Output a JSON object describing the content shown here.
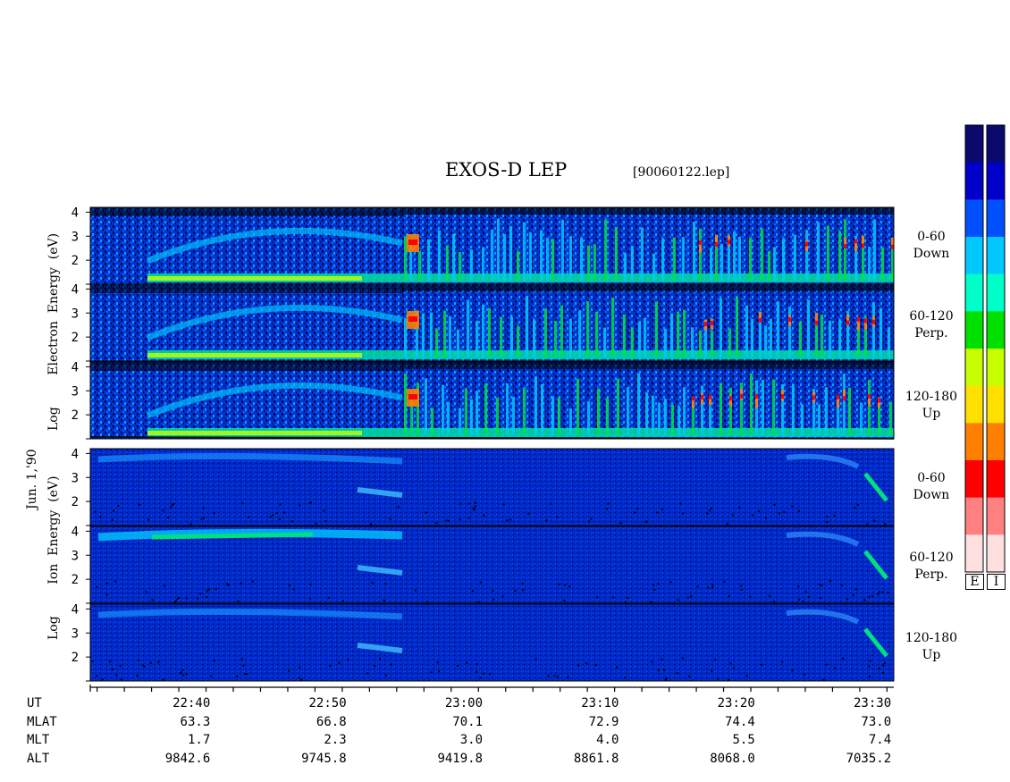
{
  "chart_data": {
    "type": "heatmap",
    "title": "EXOS-D LEP",
    "file_label": "[90060122.lep]",
    "date_label": "Jun. 1,'90",
    "groups": [
      {
        "species": "Electron",
        "ylabel_parts": [
          "Log",
          "Electron",
          "Energy",
          "(eV)"
        ],
        "panels": [
          {
            "pitch": "0-60",
            "direction": "Down"
          },
          {
            "pitch": "60-120",
            "direction": "Perp."
          },
          {
            "pitch": "120-180",
            "direction": "Up"
          }
        ]
      },
      {
        "species": "Ion",
        "ylabel_parts": [
          "Log",
          "Ion",
          "Energy",
          "(eV)"
        ],
        "panels": [
          {
            "pitch": "0-60",
            "direction": "Down"
          },
          {
            "pitch": "60-120",
            "direction": "Perp."
          },
          {
            "pitch": "120-180",
            "direction": "Up"
          }
        ]
      }
    ],
    "y_ticks": [
      "2",
      "3",
      "4"
    ],
    "ylim": [
      1,
      4.2
    ],
    "x_ticks": [
      "22:40",
      "22:50",
      "23:00",
      "23:10",
      "23:20",
      "23:30"
    ],
    "orbit_rows": [
      {
        "name": "UT",
        "values": [
          "22:40",
          "22:50",
          "23:00",
          "23:10",
          "23:20",
          "23:30"
        ]
      },
      {
        "name": "MLAT",
        "values": [
          "63.3",
          "66.8",
          "70.1",
          "72.9",
          "74.4",
          "73.0"
        ]
      },
      {
        "name": "MLT",
        "values": [
          "1.7",
          "2.3",
          "3.0",
          "4.0",
          "5.5",
          "7.4"
        ]
      },
      {
        "name": "ALT",
        "values": [
          "9842.6",
          "9745.8",
          "9419.8",
          "8861.8",
          "8068.0",
          "7035.2"
        ]
      }
    ],
    "colorbars": [
      {
        "label": "E"
      },
      {
        "label": "I"
      }
    ],
    "colorscale": [
      "#0a0a6e",
      "#0000c8",
      "#0050ff",
      "#00c8ff",
      "#00ffc8",
      "#00e000",
      "#c8ff00",
      "#ffe000",
      "#ff8000",
      "#ff0000",
      "#ff8080",
      "#ffe0e0"
    ],
    "grid": false
  }
}
